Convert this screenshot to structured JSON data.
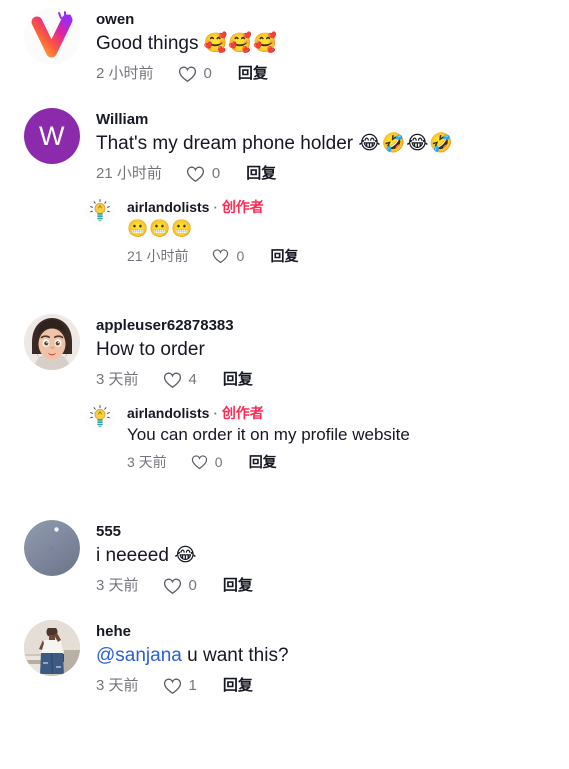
{
  "app": {
    "platform_accent": "#fe2c55",
    "link_color": "#2b5fd9",
    "text_color": "#161823",
    "muted_color": "#16182399"
  },
  "labels": {
    "reply": "回复",
    "creator_badge": "创作者",
    "separator": "·",
    "heart_icon": "heart-outline-icon"
  },
  "comments": [
    {
      "id": "c1",
      "username": "owen",
      "avatar_type": "logo-v-gradient",
      "avatar_initial": "",
      "text": "Good things ",
      "emojis": "🥰🥰🥰",
      "mention": "",
      "time": "2 小时前",
      "likes": "0",
      "reply_label": "回复",
      "replies": []
    },
    {
      "id": "c2",
      "username": "William",
      "avatar_type": "initial-purple",
      "avatar_initial": "W",
      "text": "That's my dream phone holder ",
      "emojis": "😂🤣😂🤣",
      "mention": "",
      "time": "21 小时前",
      "likes": "0",
      "reply_label": "回复",
      "replies": [
        {
          "id": "c2r1",
          "username": "airlandolists",
          "avatar_type": "lightbulb",
          "is_creator": true,
          "creator_badge": "创作者",
          "text": "",
          "emojis": "😬😬😬",
          "time": "21 小时前",
          "likes": "0",
          "reply_label": "回复"
        }
      ]
    },
    {
      "id": "c3",
      "username": "appleuser62878383",
      "avatar_type": "memoji-face",
      "avatar_initial": "",
      "text": "How to order",
      "emojis": "",
      "mention": "",
      "time": "3 天前",
      "likes": "4",
      "reply_label": "回复",
      "replies": [
        {
          "id": "c3r1",
          "username": "airlandolists",
          "avatar_type": "lightbulb",
          "is_creator": true,
          "creator_badge": "创作者",
          "text": "You can order it on my profile website",
          "emojis": "",
          "time": "3 天前",
          "likes": "0",
          "reply_label": "回复"
        }
      ]
    },
    {
      "id": "c4",
      "username": "555",
      "avatar_type": "gray-gradient",
      "avatar_initial": "",
      "text": "i neeeed ",
      "emojis": "😂",
      "mention": "",
      "time": "3 天前",
      "likes": "0",
      "reply_label": "回复",
      "replies": []
    },
    {
      "id": "c5",
      "username": "hehe",
      "avatar_type": "photo-person",
      "avatar_initial": "",
      "mention": "@sanjana",
      "text": " u want this?",
      "emojis": "",
      "time": "3 天前",
      "likes": "1",
      "reply_label": "回复",
      "replies": []
    }
  ]
}
